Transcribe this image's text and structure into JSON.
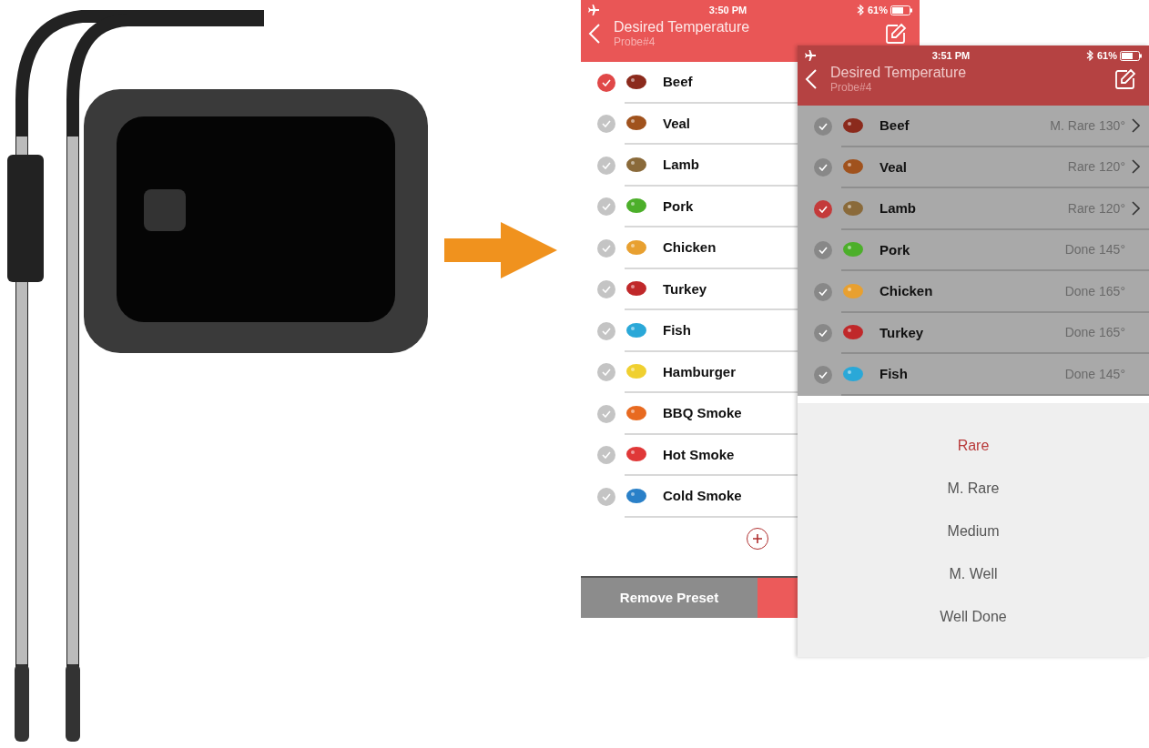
{
  "screens": [
    {
      "dimmed": false,
      "time": "3:50 PM",
      "battery": "61%",
      "title": "Desired Temperature",
      "subtitle": "Probe#4",
      "items": [
        {
          "name": "Beef",
          "color": "#8b2a1c",
          "selected": true
        },
        {
          "name": "Veal",
          "color": "#a0521d",
          "selected": false
        },
        {
          "name": "Lamb",
          "color": "#8a6a3a",
          "selected": false
        },
        {
          "name": "Pork",
          "color": "#4caf2a",
          "selected": false
        },
        {
          "name": "Chicken",
          "color": "#e8a030",
          "selected": false
        },
        {
          "name": "Turkey",
          "color": "#c0282a",
          "selected": false
        },
        {
          "name": "Fish",
          "color": "#2aa8d8",
          "selected": false
        },
        {
          "name": "Hamburger",
          "color": "#f0d030",
          "selected": false
        },
        {
          "name": "BBQ Smoke",
          "color": "#e86a20",
          "selected": false
        },
        {
          "name": "Hot Smoke",
          "color": "#e03838",
          "selected": false
        },
        {
          "name": "Cold Smoke",
          "color": "#2a80c8",
          "selected": false
        }
      ],
      "remove_button": "Remove Preset"
    },
    {
      "dimmed": true,
      "time": "3:51 PM",
      "battery": "61%",
      "title": "Desired Temperature",
      "subtitle": "Probe#4",
      "items": [
        {
          "name": "Beef",
          "color": "#8b2a1c",
          "selected": false,
          "value": "M. Rare 130°",
          "chevron": true
        },
        {
          "name": "Veal",
          "color": "#a0521d",
          "selected": false,
          "value": "Rare 120°",
          "chevron": true
        },
        {
          "name": "Lamb",
          "color": "#8a6a3a",
          "selected": true,
          "value": "Rare 120°",
          "chevron": true
        },
        {
          "name": "Pork",
          "color": "#4caf2a",
          "selected": false,
          "value": "Done 145°",
          "chevron": false
        },
        {
          "name": "Chicken",
          "color": "#e8a030",
          "selected": false,
          "value": "Done 165°",
          "chevron": false
        },
        {
          "name": "Turkey",
          "color": "#c0282a",
          "selected": false,
          "value": "Done 165°",
          "chevron": false
        },
        {
          "name": "Fish",
          "color": "#2aa8d8",
          "selected": false,
          "value": "Done 145°",
          "chevron": false
        }
      ],
      "picker": [
        {
          "label": "Rare",
          "selected": true
        },
        {
          "label": "M. Rare",
          "selected": false
        },
        {
          "label": "Medium",
          "selected": false
        },
        {
          "label": "M. Well",
          "selected": false
        },
        {
          "label": "Well Done",
          "selected": false
        }
      ]
    }
  ]
}
